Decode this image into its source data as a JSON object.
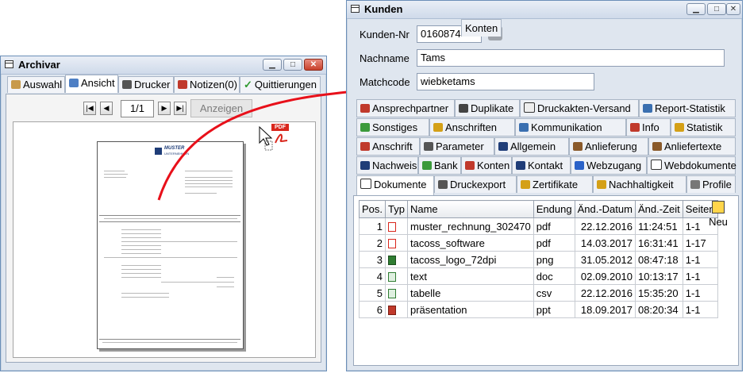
{
  "archivar": {
    "title": "Archivar",
    "tabs": [
      "Auswahl",
      "Ansicht",
      "Drucker",
      "Notizen(0)",
      "Quittierungen"
    ],
    "active_tab": "Ansicht",
    "pager": "1/1",
    "show_button": "Anzeigen",
    "preview_logo_line1": "MUSTER",
    "preview_logo_line2": "UNTERNEHMEN"
  },
  "pdf_badge": "PDF",
  "kunden": {
    "title": "Kunden",
    "fields": {
      "kundennr_label": "Kunden-Nr",
      "kundennr_value": "0160874",
      "nachname_label": "Nachname",
      "nachname_value": "Tams",
      "matchcode_label": "Matchcode",
      "matchcode_value": "wiebketams"
    },
    "tab_rows": [
      [
        "Ansprechpartner",
        "Duplikate",
        "Druckakten-Versand",
        "Report-Statistik"
      ],
      [
        "Sonstiges",
        "Anschriften",
        "Kommunikation",
        "Info",
        "Statistik"
      ],
      [
        "Anschrift",
        "Parameter",
        "Allgemein",
        "Anlieferung",
        "Anliefertexte"
      ],
      [
        "Nachweis",
        "Bank",
        "Konten",
        "Kontakt",
        "Webzugang",
        "Webdokumente"
      ],
      [
        "Dokumente",
        "Druckexport",
        "Zertifikate",
        "Nachhaltigkeit",
        "Profile"
      ]
    ],
    "active_tab": "Dokumente",
    "table": {
      "headers": [
        "Pos.",
        "Typ",
        "Name",
        "Endung",
        "Änd.-Datum",
        "Änd.-Zeit",
        "Seiten"
      ],
      "rows": [
        {
          "pos": "1",
          "icon": "pdf-file-icon",
          "name": "muster_rechnung_302470",
          "ext": "pdf",
          "date": "22.12.2016",
          "time": "11:24:51",
          "pages": "1-1"
        },
        {
          "pos": "2",
          "icon": "pdf-file-icon",
          "name": "tacoss_software",
          "ext": "pdf",
          "date": "14.03.2017",
          "time": "16:31:41",
          "pages": "1-17"
        },
        {
          "pos": "3",
          "icon": "image-file-icon",
          "name": "tacoss_logo_72dpi",
          "ext": "png",
          "date": "31.05.2012",
          "time": "08:47:18",
          "pages": "1-1"
        },
        {
          "pos": "4",
          "icon": "doc-file-icon",
          "name": "text",
          "ext": "doc",
          "date": "02.09.2010",
          "time": "10:13:17",
          "pages": "1-1"
        },
        {
          "pos": "5",
          "icon": "csv-file-icon",
          "name": "tabelle",
          "ext": "csv",
          "date": "22.12.2016",
          "time": "15:35:20",
          "pages": "1-1"
        },
        {
          "pos": "6",
          "icon": "ppt-file-icon",
          "name": "präsentation",
          "ext": "ppt",
          "date": "18.09.2017",
          "time": "08:20:34",
          "pages": "1-1"
        }
      ]
    },
    "new_button": "Neu"
  },
  "colors": {
    "arrow": "#e8101a",
    "window_border": "#6b8fb8",
    "title_bg": "#dbe4f0"
  }
}
